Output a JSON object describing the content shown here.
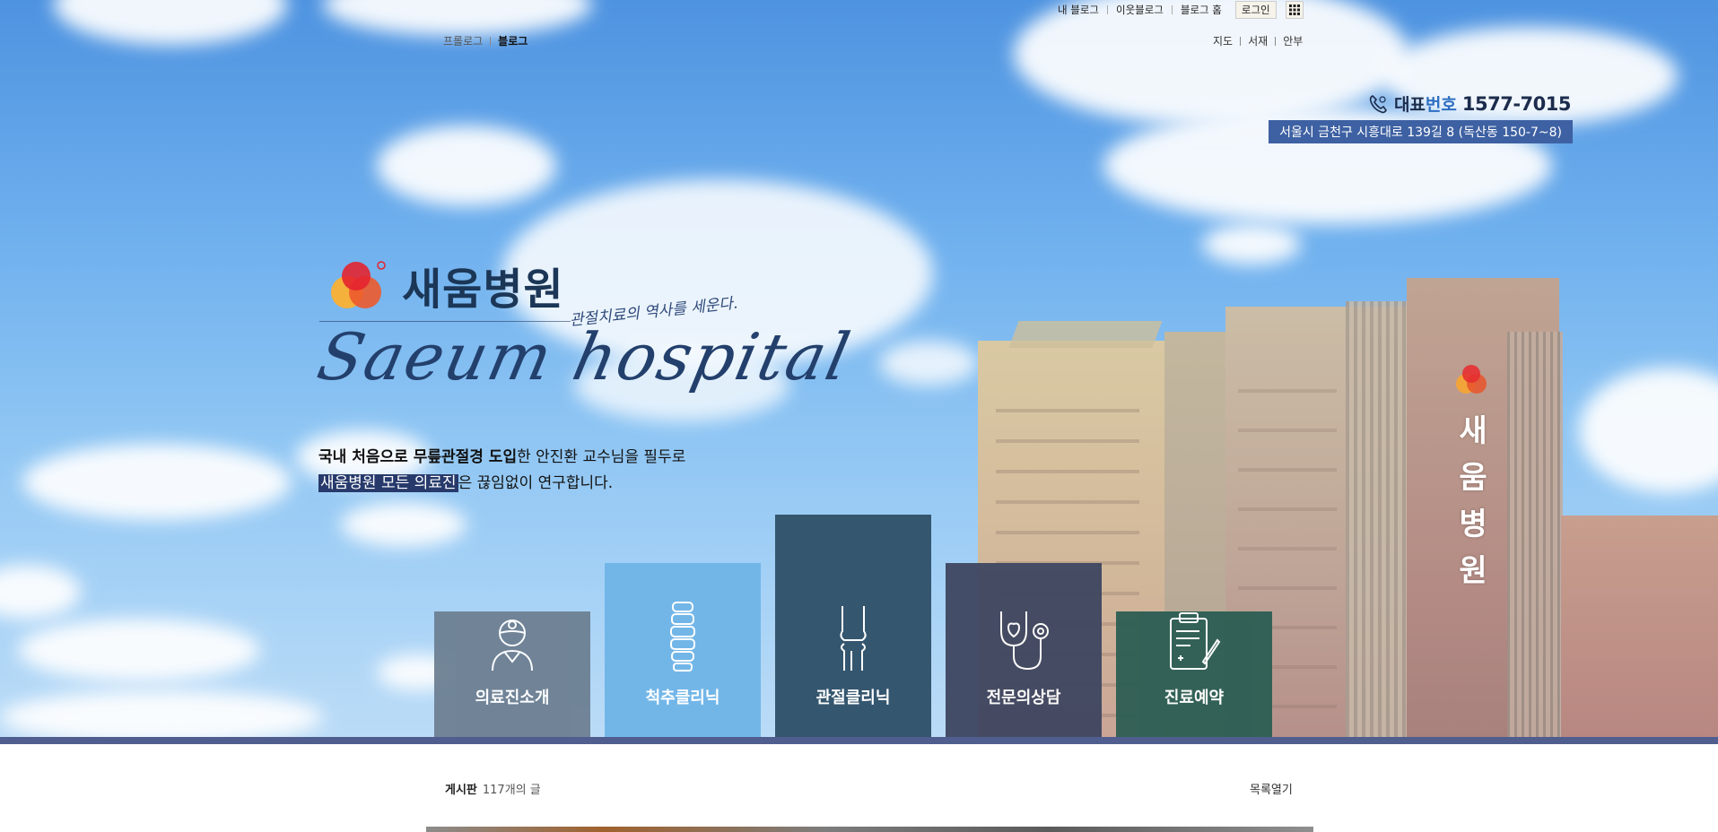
{
  "utility_nav": {
    "my_blog": "내 블로그",
    "neighbor_blog": "이웃블로그",
    "blog_home": "블로그 홈",
    "login": "로그인"
  },
  "blog_tabs": {
    "prologue": "프롤로그",
    "blog": "블로그"
  },
  "map_menu": {
    "map": "지도",
    "library": "서재",
    "guestbook": "안부"
  },
  "contact": {
    "label_a": "대표",
    "label_b": "번호",
    "phone": "1577-7015",
    "address": "서울시 금천구 시흥대로 139길 8 (독산동 150-7~8)"
  },
  "brand": {
    "name": "새움병원",
    "slogan": "관절치료의 역사를 세운다.",
    "script": "Saeum hospital",
    "building_sign": [
      "새",
      "움",
      "병",
      "원"
    ]
  },
  "description": {
    "line1_bold1": "국내 처음으로 ",
    "line1_bold2": "무릎관절경 도입",
    "line1_rest": "한 안진환 교수님을 필두로",
    "line2_hl": "새움병원 모든 의료진",
    "line2_rest": "은 끊임없이 연구합니다."
  },
  "menu": [
    {
      "label": "의료진소개",
      "icon": "doctor-icon",
      "color": "#6d7f92"
    },
    {
      "label": "척추클리닉",
      "icon": "spine-icon",
      "color": "#72b6e8"
    },
    {
      "label": "관절클리닉",
      "icon": "knee-joint-icon",
      "color": "#35566f"
    },
    {
      "label": "전문의상담",
      "icon": "stethoscope-icon",
      "color": "#3e4660"
    },
    {
      "label": "진료예약",
      "icon": "clipboard-icon",
      "color": "#2f5f55"
    }
  ],
  "board": {
    "title": "게시판",
    "count": "117개의 글",
    "toggle": "목록열기"
  }
}
